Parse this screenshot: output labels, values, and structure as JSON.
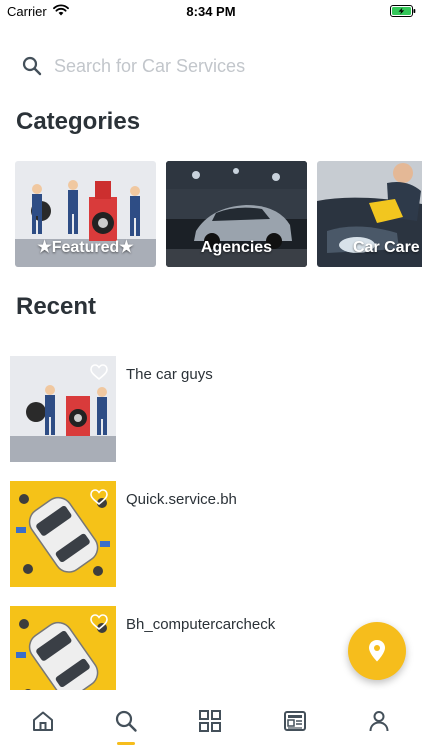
{
  "status_bar": {
    "carrier": "Carrier",
    "time": "8:34 PM"
  },
  "search": {
    "placeholder": "Search for Car Services",
    "value": ""
  },
  "categories": {
    "title": "Categories",
    "items": [
      {
        "label": "★Featured★"
      },
      {
        "label": "Agencies"
      },
      {
        "label": "Car Care"
      }
    ]
  },
  "recent": {
    "title": "Recent",
    "items": [
      {
        "name": "The car guys",
        "favorited": false
      },
      {
        "name": "Quick.service.bh",
        "favorited": false
      },
      {
        "name": "Bh_computercarcheck",
        "favorited": false
      }
    ]
  },
  "tab_bar": {
    "active": "search",
    "tabs": [
      "home",
      "search",
      "categories",
      "news",
      "profile"
    ]
  },
  "colors": {
    "accent": "#f6bd1c",
    "text": "#2b3238",
    "icon": "#44505a"
  },
  "icons": {
    "search": "search-icon",
    "heart": "heart-icon",
    "fab": "location-pin-icon",
    "home": "home-icon",
    "grid": "grid-icon",
    "news": "news-icon",
    "profile": "user-icon"
  }
}
